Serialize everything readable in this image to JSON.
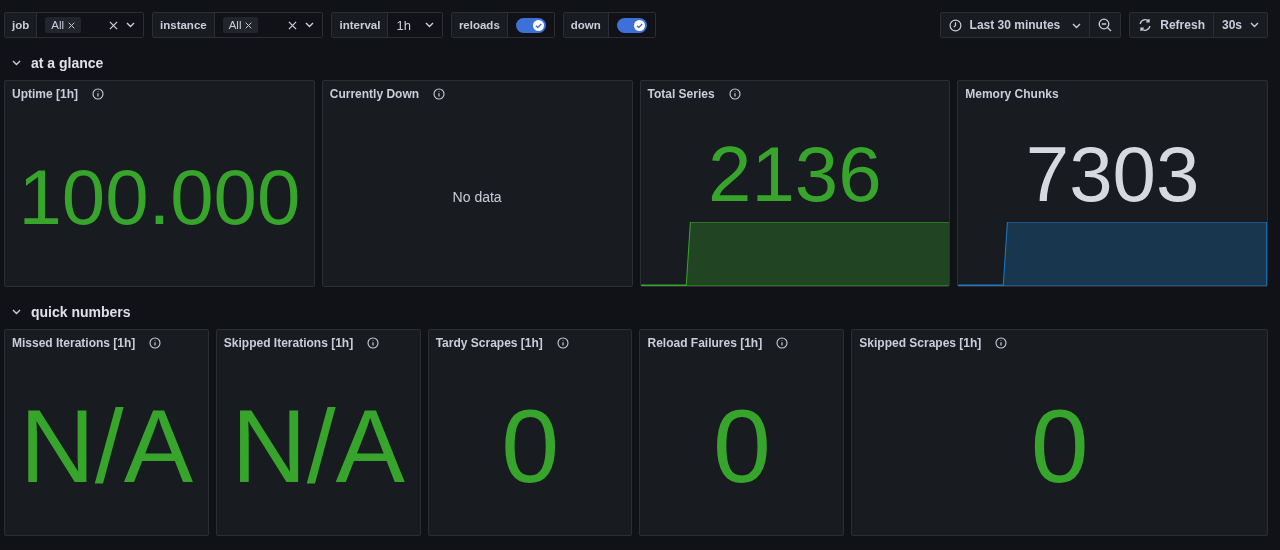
{
  "variables": [
    {
      "kind": "multi",
      "label": "job",
      "chips": [
        "All"
      ]
    },
    {
      "kind": "multi",
      "label": "instance",
      "chips": [
        "All"
      ]
    },
    {
      "kind": "select",
      "label": "interval",
      "value": "1h"
    },
    {
      "kind": "switch",
      "label": "reloads",
      "on": true
    },
    {
      "kind": "switch",
      "label": "down",
      "on": true
    }
  ],
  "time_picker": {
    "label": "Last 30 minutes"
  },
  "refresh": {
    "label": "Refresh",
    "interval": "30s"
  },
  "rows": [
    {
      "title": "at a glance",
      "expanded": true,
      "panels": [
        {
          "title": "Uptime [1h]",
          "info": true,
          "kind": "value",
          "value": "100.000",
          "color": "#37a52c"
        },
        {
          "title": "Currently Down",
          "info": true,
          "kind": "nodata",
          "value": "No data"
        },
        {
          "title": "Total Series",
          "info": true,
          "kind": "sparkline",
          "value": "2136",
          "color": "#37a52c",
          "sparkline": {
            "color": "#37a52c"
          }
        },
        {
          "title": "Memory Chunks",
          "info": false,
          "kind": "sparkline",
          "value": "7303",
          "color": "#d8d9e0",
          "sparkline": {
            "color": "#1f78c1"
          }
        }
      ]
    },
    {
      "title": "quick numbers",
      "expanded": true,
      "panels": [
        {
          "title": "Missed Iterations [1h]",
          "info": true,
          "kind": "value",
          "value": "N/A",
          "color": "#37a52c"
        },
        {
          "title": "Skipped Iterations [1h]",
          "info": true,
          "kind": "value",
          "value": "N/A",
          "color": "#37a52c"
        },
        {
          "title": "Tardy Scrapes [1h]",
          "info": true,
          "kind": "value",
          "value": "0",
          "color": "#37a52c"
        },
        {
          "title": "Reload Failures [1h]",
          "info": true,
          "kind": "value",
          "value": "0",
          "color": "#37a52c"
        },
        {
          "title": "Skipped Scrapes [1h]",
          "info": true,
          "kind": "value",
          "value": "0",
          "color": "#37a52c",
          "wide": true
        }
      ]
    }
  ]
}
